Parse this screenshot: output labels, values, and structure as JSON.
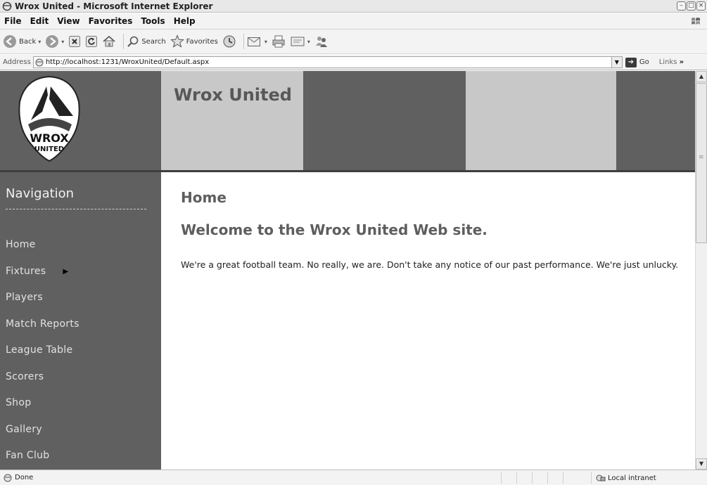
{
  "window": {
    "title": "Wrox United - Microsoft Internet Explorer"
  },
  "menu": {
    "items": [
      "File",
      "Edit",
      "View",
      "Favorites",
      "Tools",
      "Help"
    ]
  },
  "toolbar": {
    "back_label": "Back",
    "search_label": "Search",
    "favorites_label": "Favorites"
  },
  "addressbar": {
    "label": "Address",
    "url": "http://localhost:1231/WroxUnited/Default.aspx",
    "go_label": "Go",
    "links_label": "Links"
  },
  "site": {
    "logo_text_line1": "WROX",
    "logo_text_line2": "UNITED",
    "title": "Wrox United"
  },
  "navigation": {
    "heading": "Navigation",
    "items": [
      {
        "label": "Home"
      },
      {
        "label": "Fixtures",
        "has_submenu": true
      },
      {
        "label": "Players"
      },
      {
        "label": "Match Reports"
      },
      {
        "label": "League Table"
      },
      {
        "label": "Scorers"
      },
      {
        "label": "Shop"
      },
      {
        "label": "Gallery"
      },
      {
        "label": "Fan Club"
      }
    ]
  },
  "content": {
    "page_heading": "Home",
    "welcome": "Welcome to the Wrox United Web site.",
    "intro": "We're a great football team. No really, we are. Don't take any notice of our past performance. We're just unlucky."
  },
  "statusbar": {
    "status": "Done",
    "zone": "Local intranet"
  }
}
